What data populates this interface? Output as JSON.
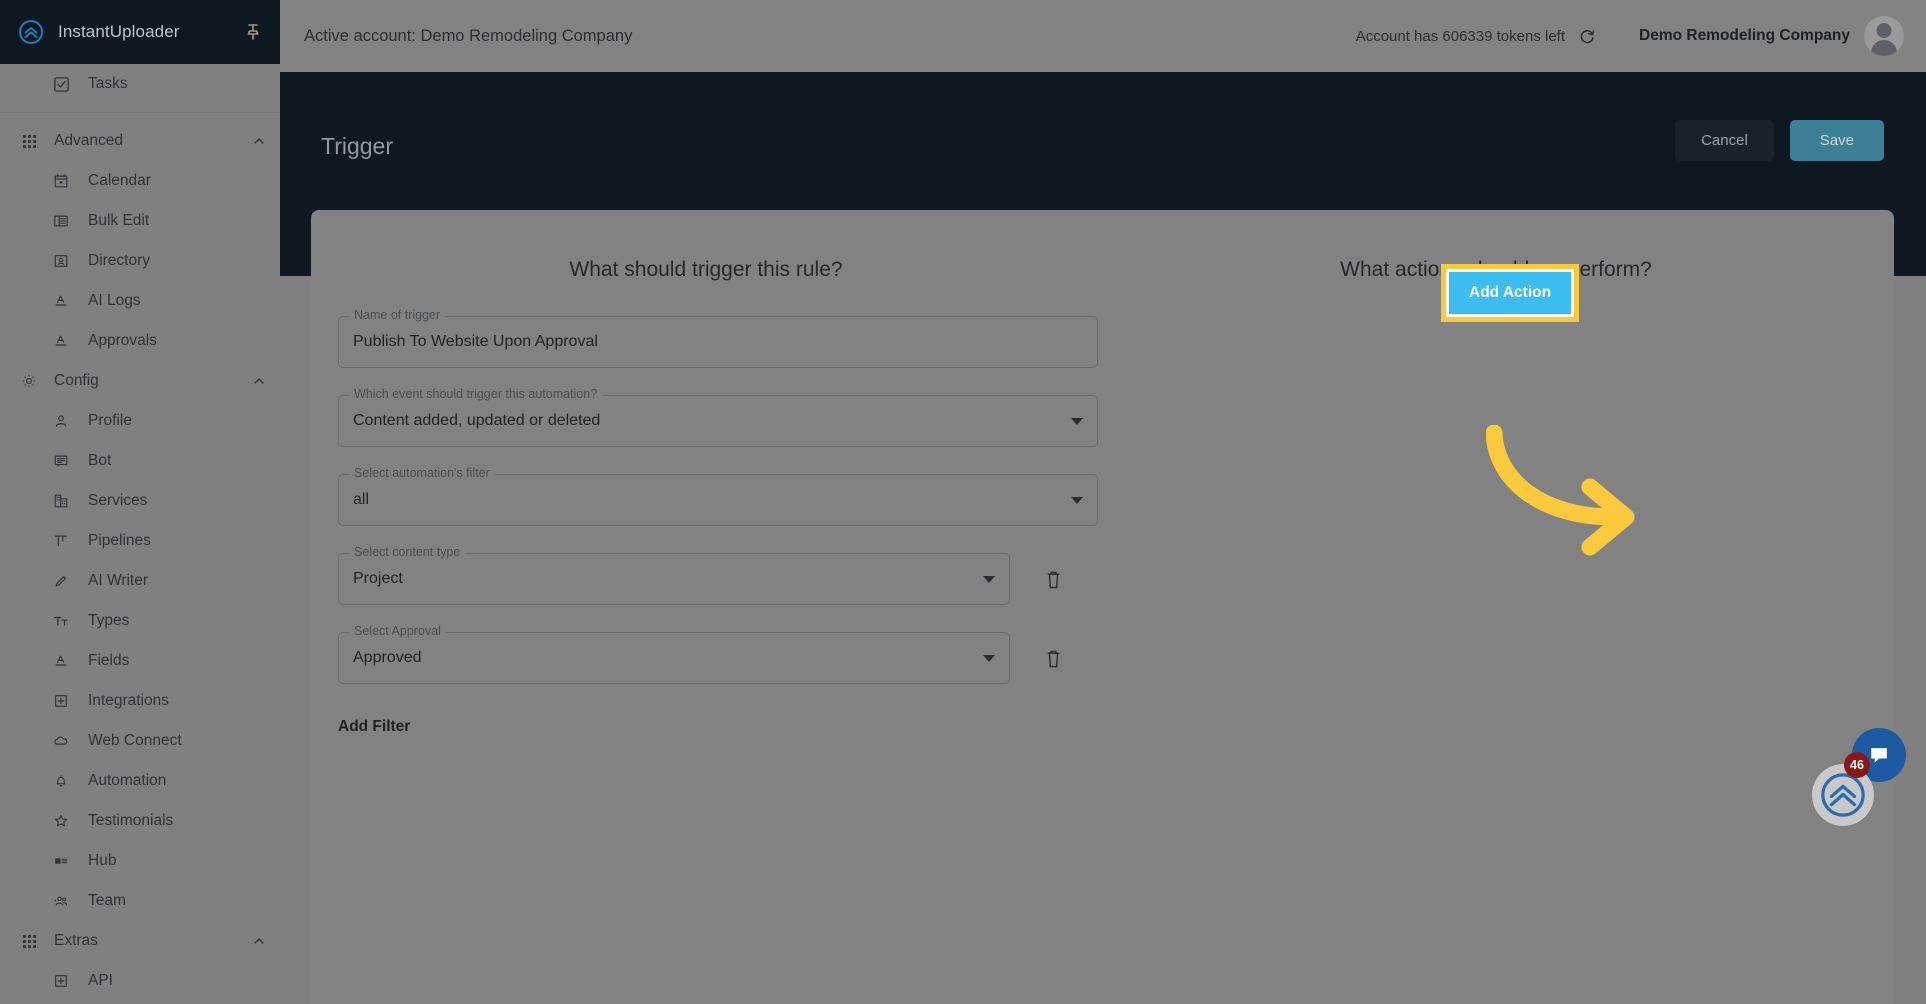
{
  "brand": {
    "name": "InstantUploader",
    "logo_icon": "double-chevron-up-circle-icon",
    "pin_icon": "pin-icon"
  },
  "sidebar": {
    "top_items": [
      {
        "label": "Tasks",
        "icon": "checkbox-icon"
      }
    ],
    "groups": [
      {
        "label": "Advanced",
        "icon": "grid-icon",
        "chevron": "chevron-up-icon",
        "items": [
          {
            "label": "Calendar",
            "icon": "calendar-icon"
          },
          {
            "label": "Bulk Edit",
            "icon": "table-list-icon"
          },
          {
            "label": "Directory",
            "icon": "contact-card-icon"
          },
          {
            "label": "AI Logs",
            "icon": "text-format-icon"
          },
          {
            "label": "Approvals",
            "icon": "text-format-icon"
          }
        ]
      },
      {
        "label": "Config",
        "icon": "gear-icon",
        "chevron": "chevron-up-icon",
        "items": [
          {
            "label": "Profile",
            "icon": "person-icon"
          },
          {
            "label": "Bot",
            "icon": "chat-lines-icon"
          },
          {
            "label": "Services",
            "icon": "building-icon"
          },
          {
            "label": "Pipelines",
            "icon": "column-width-icon"
          },
          {
            "label": "AI Writer",
            "icon": "pencil-icon"
          },
          {
            "label": "Types",
            "icon": "text-size-icon"
          },
          {
            "label": "Fields",
            "icon": "text-format-icon"
          },
          {
            "label": "Integrations",
            "icon": "plus-square-icon"
          },
          {
            "label": "Web Connect",
            "icon": "cloud-icon"
          },
          {
            "label": "Automation",
            "icon": "bell-icon"
          },
          {
            "label": "Testimonials",
            "icon": "star-icon"
          },
          {
            "label": "Hub",
            "icon": "media-list-icon"
          },
          {
            "label": "Team",
            "icon": "people-icon"
          }
        ]
      },
      {
        "label": "Extras",
        "icon": "grid-icon",
        "chevron": "chevron-up-icon",
        "items": [
          {
            "label": "API",
            "icon": "plus-square-icon"
          }
        ]
      }
    ]
  },
  "topbar": {
    "active_account": "Active account: Demo Remodeling Company",
    "tokens_text": "Account has 606339 tokens left",
    "refresh_icon": "refresh-icon",
    "account_name": "Demo Remodeling Company",
    "avatar_icon": "avatar-icon"
  },
  "panel": {
    "title": "Trigger",
    "cancel_label": "Cancel",
    "save_label": "Save"
  },
  "card": {
    "trigger_headline": "What should trigger this rule?",
    "actions_headline": "What actions should we perform?",
    "fields": [
      {
        "legend": "Name of trigger",
        "value": "Publish To Website Upon Approval",
        "type": "text",
        "has_delete": false
      },
      {
        "legend": "Which event should trigger this automation?",
        "value": "Content added, updated or deleted",
        "type": "select",
        "has_delete": false
      },
      {
        "legend": "Select automation's filter",
        "value": "all",
        "type": "select",
        "has_delete": false
      },
      {
        "legend": "Select content type",
        "value": "Project",
        "type": "select",
        "has_delete": true
      },
      {
        "legend": "Select Approval",
        "value": "Approved",
        "type": "select",
        "has_delete": true
      }
    ],
    "add_filter_label": "Add Filter",
    "add_action_label": "Add Action",
    "delete_icon": "trash-icon"
  },
  "annotation": {
    "arrow_icon": "curved-arrow-right-icon",
    "arrow_color": "#fbc93d",
    "highlight_color": "#fbc93d"
  },
  "floating": {
    "chat_icon": "chat-bubble-icon",
    "helper_icon": "double-chevron-up-circle-icon",
    "badge_count": "46"
  },
  "colors": {
    "brand_dark": "#0e1821",
    "overlay_gray": "#828282",
    "accent_blue": "#3bbdef",
    "save_teal": "#3c7f96",
    "highlight_yellow": "#fbc93d",
    "badge_red": "#8a1616",
    "chat_blue": "#1c5ba3"
  }
}
